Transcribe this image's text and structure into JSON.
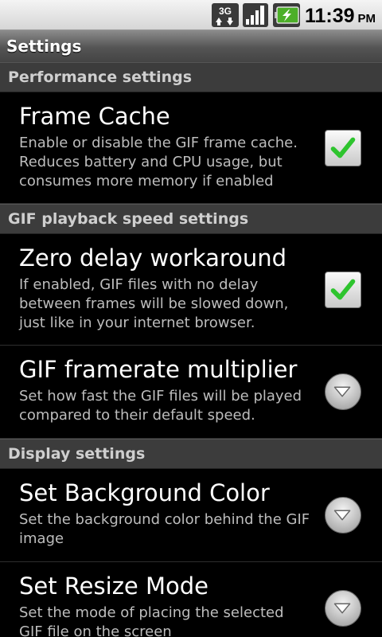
{
  "status_bar": {
    "network": "3G",
    "time": "11:39",
    "ampm": "PM",
    "icons": [
      "3g-data-icon",
      "signal-strength-icon",
      "battery-charging-icon"
    ],
    "battery_color": "#4caf28"
  },
  "title_bar": {
    "title": "Settings"
  },
  "sections": [
    {
      "header": "Performance settings",
      "items": [
        {
          "title": "Frame Cache",
          "summary": "Enable or disable the GIF frame cache. Reduces battery and CPU usage, but consumes more memory if enabled",
          "widget": "checkbox",
          "checked": true
        }
      ]
    },
    {
      "header": "GIF playback speed settings",
      "items": [
        {
          "title": "Zero delay workaround",
          "summary": "If enabled, GIF files with no delay between frames will be slowed down, just like in your internet browser.",
          "widget": "checkbox",
          "checked": true
        },
        {
          "title": "GIF framerate multiplier",
          "summary": "Set how fast the GIF files will be played compared to their default speed.",
          "widget": "dropdown"
        }
      ]
    },
    {
      "header": "Display settings",
      "items": [
        {
          "title": "Set Background Color",
          "summary": "Set the background color behind the GIF image",
          "widget": "dropdown"
        },
        {
          "title": "Set Resize Mode",
          "summary": "Set the mode of placing the selected GIF file on the screen",
          "widget": "dropdown"
        }
      ]
    }
  ],
  "colors": {
    "check_green": "#2ec42e",
    "category_bg": "#3c3c3c"
  }
}
